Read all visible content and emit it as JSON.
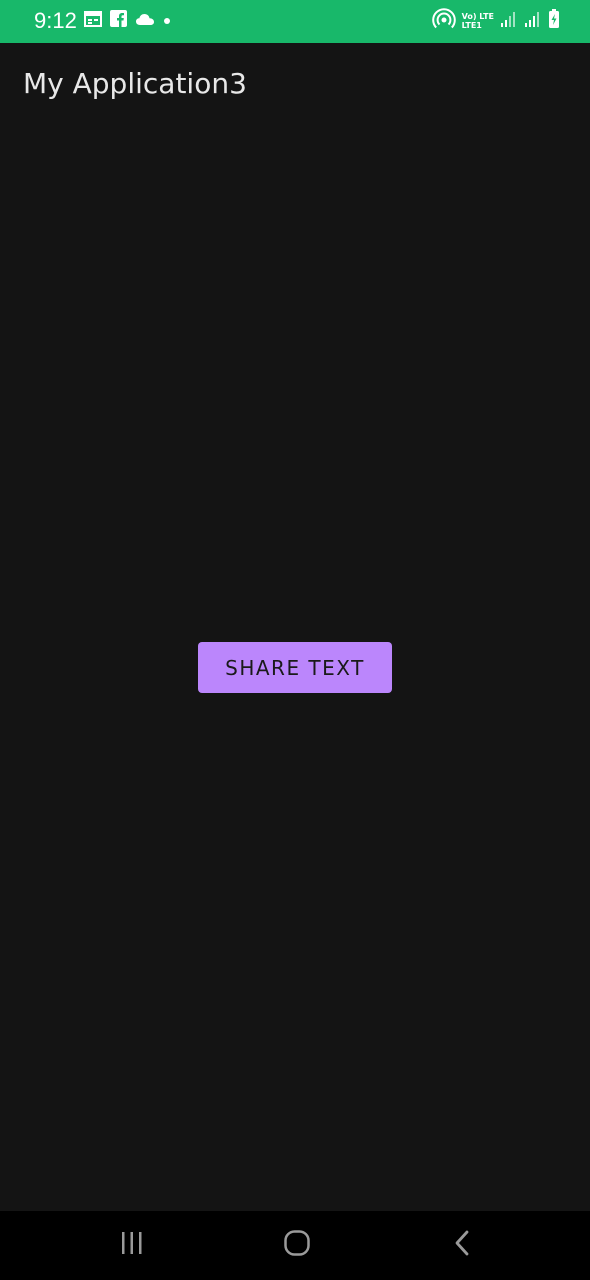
{
  "status_bar": {
    "time": "9:12",
    "color": "#18b86a",
    "left_icons": [
      "calendar-icon",
      "facebook-icon",
      "cloud-icon",
      "dot-icon"
    ],
    "network_label_top": "Vo) LTE",
    "network_label_bottom": "LTE1",
    "right_icons": [
      "hotspot-icon",
      "network-label",
      "signal-icon",
      "signal-icon",
      "battery-charging-icon"
    ]
  },
  "app_bar": {
    "title": "My Application3"
  },
  "main": {
    "share_button_label": "SHARE TEXT",
    "button_color": "#bb86fc",
    "background_color": "#141414"
  },
  "nav_bar": {
    "buttons": [
      "recents-icon",
      "home-icon",
      "back-icon"
    ]
  }
}
